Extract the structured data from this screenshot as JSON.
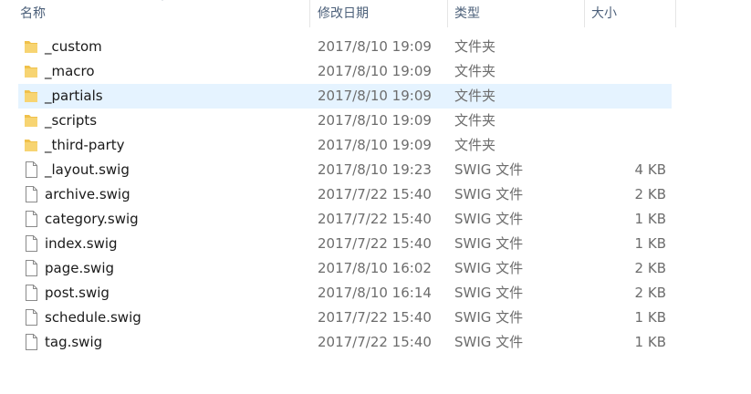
{
  "columns": {
    "name": "名称",
    "modified": "修改日期",
    "type": "类型",
    "size": "大小"
  },
  "colors": {
    "header_text": "#4c607a",
    "selection_bg": "#e5f3ff",
    "folder_icon": "#f0c14b",
    "secondary_text": "#6d6d6d"
  },
  "files": [
    {
      "icon": "folder-icon",
      "name": "_custom",
      "modified": "2017/8/10 19:09",
      "type": "文件夹",
      "size": ""
    },
    {
      "icon": "folder-icon",
      "name": "_macro",
      "modified": "2017/8/10 19:09",
      "type": "文件夹",
      "size": ""
    },
    {
      "icon": "folder-icon",
      "name": "_partials",
      "modified": "2017/8/10 19:09",
      "type": "文件夹",
      "size": "",
      "selected": true
    },
    {
      "icon": "folder-icon",
      "name": "_scripts",
      "modified": "2017/8/10 19:09",
      "type": "文件夹",
      "size": ""
    },
    {
      "icon": "folder-icon",
      "name": "_third-party",
      "modified": "2017/8/10 19:09",
      "type": "文件夹",
      "size": ""
    },
    {
      "icon": "file-icon",
      "name": "_layout.swig",
      "modified": "2017/8/10 19:23",
      "type": "SWIG 文件",
      "size": "4 KB"
    },
    {
      "icon": "file-icon",
      "name": "archive.swig",
      "modified": "2017/7/22 15:40",
      "type": "SWIG 文件",
      "size": "2 KB"
    },
    {
      "icon": "file-icon",
      "name": "category.swig",
      "modified": "2017/7/22 15:40",
      "type": "SWIG 文件",
      "size": "1 KB"
    },
    {
      "icon": "file-icon",
      "name": "index.swig",
      "modified": "2017/7/22 15:40",
      "type": "SWIG 文件",
      "size": "1 KB"
    },
    {
      "icon": "file-icon",
      "name": "page.swig",
      "modified": "2017/8/10 16:02",
      "type": "SWIG 文件",
      "size": "2 KB"
    },
    {
      "icon": "file-icon",
      "name": "post.swig",
      "modified": "2017/8/10 16:14",
      "type": "SWIG 文件",
      "size": "2 KB"
    },
    {
      "icon": "file-icon",
      "name": "schedule.swig",
      "modified": "2017/7/22 15:40",
      "type": "SWIG 文件",
      "size": "1 KB"
    },
    {
      "icon": "file-icon",
      "name": "tag.swig",
      "modified": "2017/7/22 15:40",
      "type": "SWIG 文件",
      "size": "1 KB"
    }
  ]
}
